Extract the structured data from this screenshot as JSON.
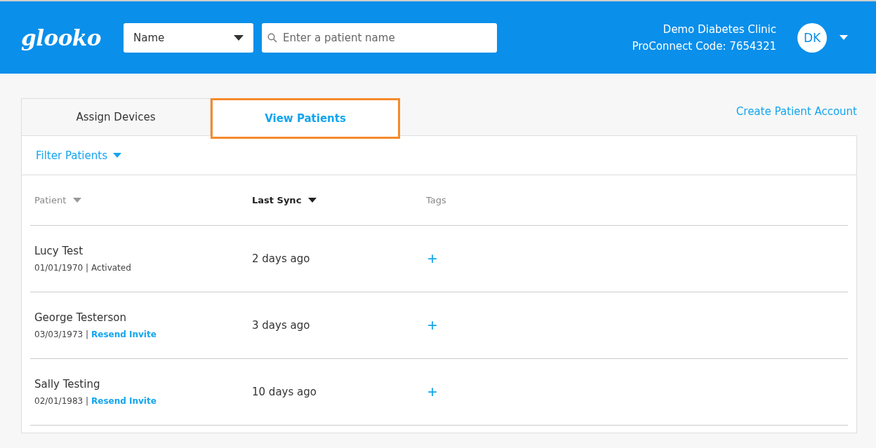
{
  "header": {
    "logo": "glooko",
    "search_by": {
      "value": "Name"
    },
    "search": {
      "placeholder": "Enter a patient name"
    },
    "clinic": "Demo Diabetes Clinic",
    "code": "ProConnect Code: 7654321",
    "avatar": "DK"
  },
  "tabs": [
    {
      "label": "Assign Devices",
      "selected": false,
      "highlighted": false
    },
    {
      "label": "View Patients",
      "selected": true,
      "highlighted": true
    }
  ],
  "create_link": "Create Patient Account",
  "filter": "Filter Patients",
  "table": {
    "columns": [
      {
        "label": "Patient",
        "sortable": true,
        "sorted": false
      },
      {
        "label": "Last Sync",
        "sortable": true,
        "sorted": true
      },
      {
        "label": "Tags",
        "sortable": false,
        "sorted": false
      }
    ],
    "rows": [
      {
        "name": "Lucy Test",
        "dob": "01/01/1970 |",
        "status": {
          "kind": "text",
          "text": "Activated"
        },
        "last_sync": "2 days ago",
        "tag_add": "+"
      },
      {
        "name": "George Testerson",
        "dob": "03/03/1973 |",
        "status": {
          "kind": "link",
          "text": "Resend Invite"
        },
        "last_sync": "3 days ago",
        "tag_add": "+"
      },
      {
        "name": "Sally Testing",
        "dob": "02/01/1983 |",
        "status": {
          "kind": "link",
          "text": "Resend Invite"
        },
        "last_sync": "10 days ago",
        "tag_add": "+"
      }
    ]
  }
}
